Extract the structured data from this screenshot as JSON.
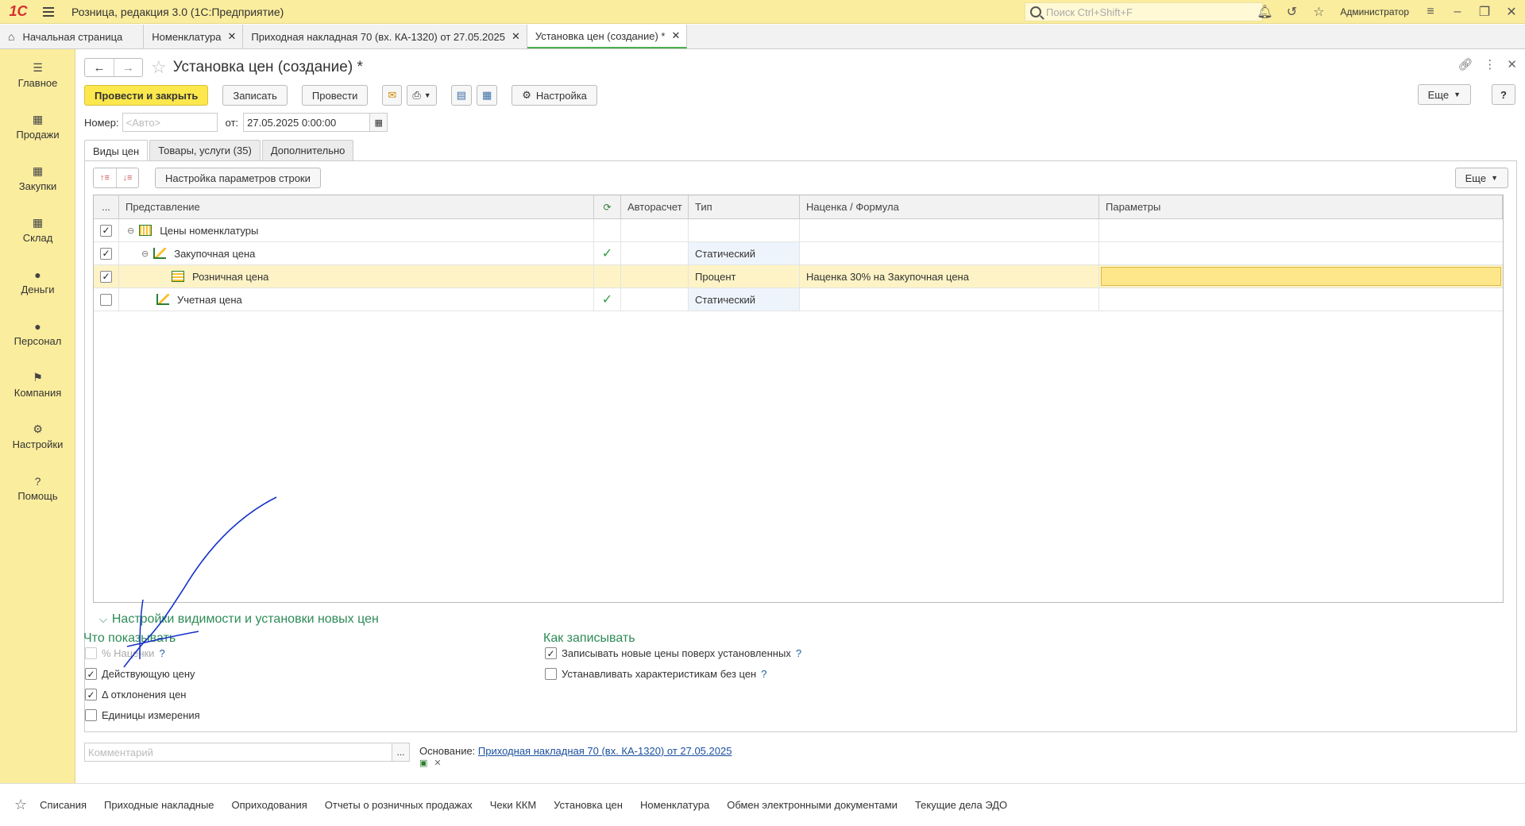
{
  "titlebar": {
    "logo": "1С",
    "app_title": "Розница, редакция 3.0  (1С:Предприятие)",
    "search_placeholder": "Поиск Ctrl+Shift+F",
    "user": "Администратор"
  },
  "open_tabs": [
    {
      "label": "Начальная страница"
    },
    {
      "label": "Номенклатура"
    },
    {
      "label": "Приходная накладная 70 (вх. КА-1320) от 27.05.2025"
    },
    {
      "label": "Установка цен (создание) *"
    }
  ],
  "nav": [
    {
      "label": "Главное",
      "icon": "menu-icon"
    },
    {
      "label": "Продажи",
      "icon": "basket-icon"
    },
    {
      "label": "Закупки",
      "icon": "cart-icon"
    },
    {
      "label": "Склад",
      "icon": "warehouse-icon"
    },
    {
      "label": "Деньги",
      "icon": "ruble-icon"
    },
    {
      "label": "Персонал",
      "icon": "people-icon"
    },
    {
      "label": "Компания",
      "icon": "flag-icon"
    },
    {
      "label": "Настройки",
      "icon": "gear-icon"
    },
    {
      "label": "Помощь",
      "icon": "help-icon"
    }
  ],
  "document": {
    "title": "Установка цен (создание) *",
    "buttons": {
      "post_close": "Провести и закрыть",
      "save": "Записать",
      "post": "Провести",
      "settings": "Настройка",
      "more": "Еще",
      "help": "?"
    },
    "number_label": "Номер:",
    "number_placeholder": "<Авто>",
    "date_label": "от:",
    "date_value": "27.05.2025  0:00:00"
  },
  "inner_tabs": [
    "Виды цен",
    "Товары, услуги (35)",
    "Дополнительно"
  ],
  "panel": {
    "row_settings_button": "Настройка параметров строки",
    "more": "Еще",
    "columns": [
      "...",
      "Представление",
      "",
      "Авторасчет",
      "Тип",
      "Наценка / Формула",
      "Параметры"
    ],
    "rows": [
      {
        "checked": true,
        "name": "Цены номенклатуры",
        "auto": false,
        "type": "",
        "formula": "",
        "params": ""
      },
      {
        "checked": true,
        "name": "Закупочная цена",
        "auto": true,
        "type": "Статический",
        "formula": "",
        "params": ""
      },
      {
        "checked": true,
        "name": "Розничная цена",
        "auto": false,
        "type": "Процент",
        "formula": "Наценка 30% на Закупочная цена",
        "params": ""
      },
      {
        "checked": false,
        "name": "Учетная цена",
        "auto": true,
        "type": "Статический",
        "formula": "",
        "params": ""
      }
    ]
  },
  "visibility": {
    "title": "Настройки видимости и установки новых цен",
    "what_show": {
      "title": "Что показывать",
      "options": [
        {
          "label": "% Наценки",
          "checked": false,
          "disabled": true,
          "help": "?"
        },
        {
          "label": "Действующую цену",
          "checked": true
        },
        {
          "label": "Δ отклонения цен",
          "checked": true
        },
        {
          "label": "Единицы измерения",
          "checked": false
        }
      ]
    },
    "how_save": {
      "title": "Как записывать",
      "options": [
        {
          "label": "Записывать новые цены поверх установленных",
          "checked": true,
          "help": "?"
        },
        {
          "label": "Устанавливать характеристикам без цен",
          "checked": false,
          "help": "?"
        }
      ]
    }
  },
  "footer": {
    "comment_placeholder": "Комментарий",
    "basis_label": "Основание:",
    "basis_link": "Приходная накладная 70 (вх. КА-1320) от 27.05.2025"
  },
  "bottom_links": [
    "Списания",
    "Приходные накладные",
    "Оприходования",
    "Отчеты о розничных продажах",
    "Чеки ККМ",
    "Установка цен",
    "Номенклатура",
    "Обмен электронными документами",
    "Текущие дела ЭДО"
  ],
  "colors": {
    "accent_yellow": "#fbed9e",
    "primary_button": "#fce74d",
    "section_green": "#2e8b57",
    "check_green": "#2e9e3e",
    "annotation_blue": "#1530c8"
  }
}
